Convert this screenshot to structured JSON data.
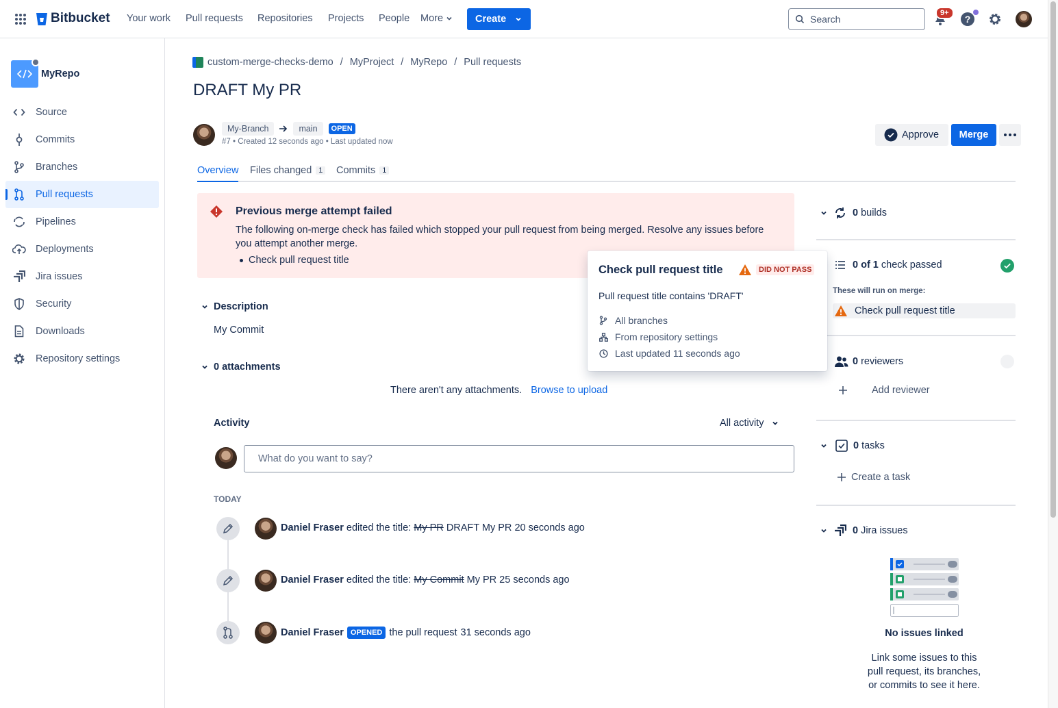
{
  "nav": {
    "brand": "Bitbucket",
    "links": [
      "Your work",
      "Pull requests",
      "Repositories",
      "Projects",
      "People",
      "More"
    ],
    "create_label": "Create",
    "search_placeholder": "Search",
    "notification_count": "9+"
  },
  "sidebar": {
    "repo_name": "MyRepo",
    "items": [
      {
        "label": "Source",
        "icon": "code-icon"
      },
      {
        "label": "Commits",
        "icon": "commit-icon"
      },
      {
        "label": "Branches",
        "icon": "branch-icon"
      },
      {
        "label": "Pull requests",
        "icon": "pull-request-icon"
      },
      {
        "label": "Pipelines",
        "icon": "pipelines-icon"
      },
      {
        "label": "Deployments",
        "icon": "cloud-upload-icon"
      },
      {
        "label": "Jira issues",
        "icon": "jira-icon"
      },
      {
        "label": "Security",
        "icon": "shield-icon"
      },
      {
        "label": "Downloads",
        "icon": "document-icon"
      },
      {
        "label": "Repository settings",
        "icon": "gear-icon"
      }
    ],
    "active_item": "Pull requests"
  },
  "breadcrumb": [
    "custom-merge-checks-demo",
    "MyProject",
    "MyRepo",
    "Pull requests"
  ],
  "pr": {
    "title": "DRAFT My PR",
    "source_branch": "My-Branch",
    "target_branch": "main",
    "state": "OPEN",
    "meta": "#7 • Created 12 seconds ago • Last updated now",
    "approve_label": "Approve",
    "merge_label": "Merge"
  },
  "tabs": [
    {
      "label": "Overview",
      "count": ""
    },
    {
      "label": "Files changed",
      "count": "1"
    },
    {
      "label": "Commits",
      "count": "1"
    }
  ],
  "alert": {
    "title": "Previous merge attempt failed",
    "body": "The following on-merge check has failed which stopped your pull request from being merged. Resolve any issues before you attempt another merge.",
    "items": [
      "Check pull request title"
    ]
  },
  "description": {
    "heading": "Description",
    "text": "My Commit"
  },
  "attachments": {
    "heading": "0 attachments",
    "empty_text": "There aren't any attachments.",
    "upload_link": "Browse to upload"
  },
  "activity": {
    "heading": "Activity",
    "filter": "All activity",
    "comment_placeholder": "What do you want to say?",
    "day_label": "TODAY",
    "events": [
      {
        "user": "Daniel Fraser",
        "action": "edited the title:",
        "old": "My PR",
        "new": "DRAFT My PR",
        "time": "20 seconds ago",
        "icon": "pencil-icon",
        "badge": ""
      },
      {
        "user": "Daniel Fraser",
        "action": "edited the title:",
        "old": "My Commit",
        "new": "My PR",
        "time": "25 seconds ago",
        "icon": "pencil-icon",
        "badge": ""
      },
      {
        "user": "Daniel Fraser",
        "action": "the pull request",
        "old": "",
        "new": "",
        "time": "31 seconds ago",
        "icon": "pull-request-icon",
        "badge": "OPENED"
      }
    ]
  },
  "popup": {
    "title": "Check pull request title",
    "status": "DID NOT PASS",
    "message": "Pull request title contains 'DRAFT'",
    "details": [
      {
        "icon": "branch-icon",
        "text": "All branches"
      },
      {
        "icon": "hierarchy-icon",
        "text": "From repository settings"
      },
      {
        "icon": "clock-icon",
        "text": "Last updated 11 seconds ago"
      }
    ]
  },
  "right": {
    "builds": {
      "count": "0",
      "label": "builds"
    },
    "checks": {
      "count": "0 of 1",
      "label": "check passed",
      "run_on_merge": "These will run on merge:",
      "item": "Check pull request title"
    },
    "reviewers": {
      "count": "0",
      "label": "reviewers",
      "add_label": "Add reviewer"
    },
    "tasks": {
      "count": "0",
      "label": "tasks",
      "create_label": "Create a task"
    },
    "jira": {
      "count": "0",
      "label": "Jira issues",
      "empty_title": "No issues linked",
      "empty_body": "Link some issues to this pull request, its branches, or commits to see it here."
    }
  },
  "colors": {
    "primary": "#0C66E4",
    "danger_bg": "#FFECEB",
    "danger": "#C9372C",
    "warning": "#E56910",
    "success": "#22A06B"
  }
}
